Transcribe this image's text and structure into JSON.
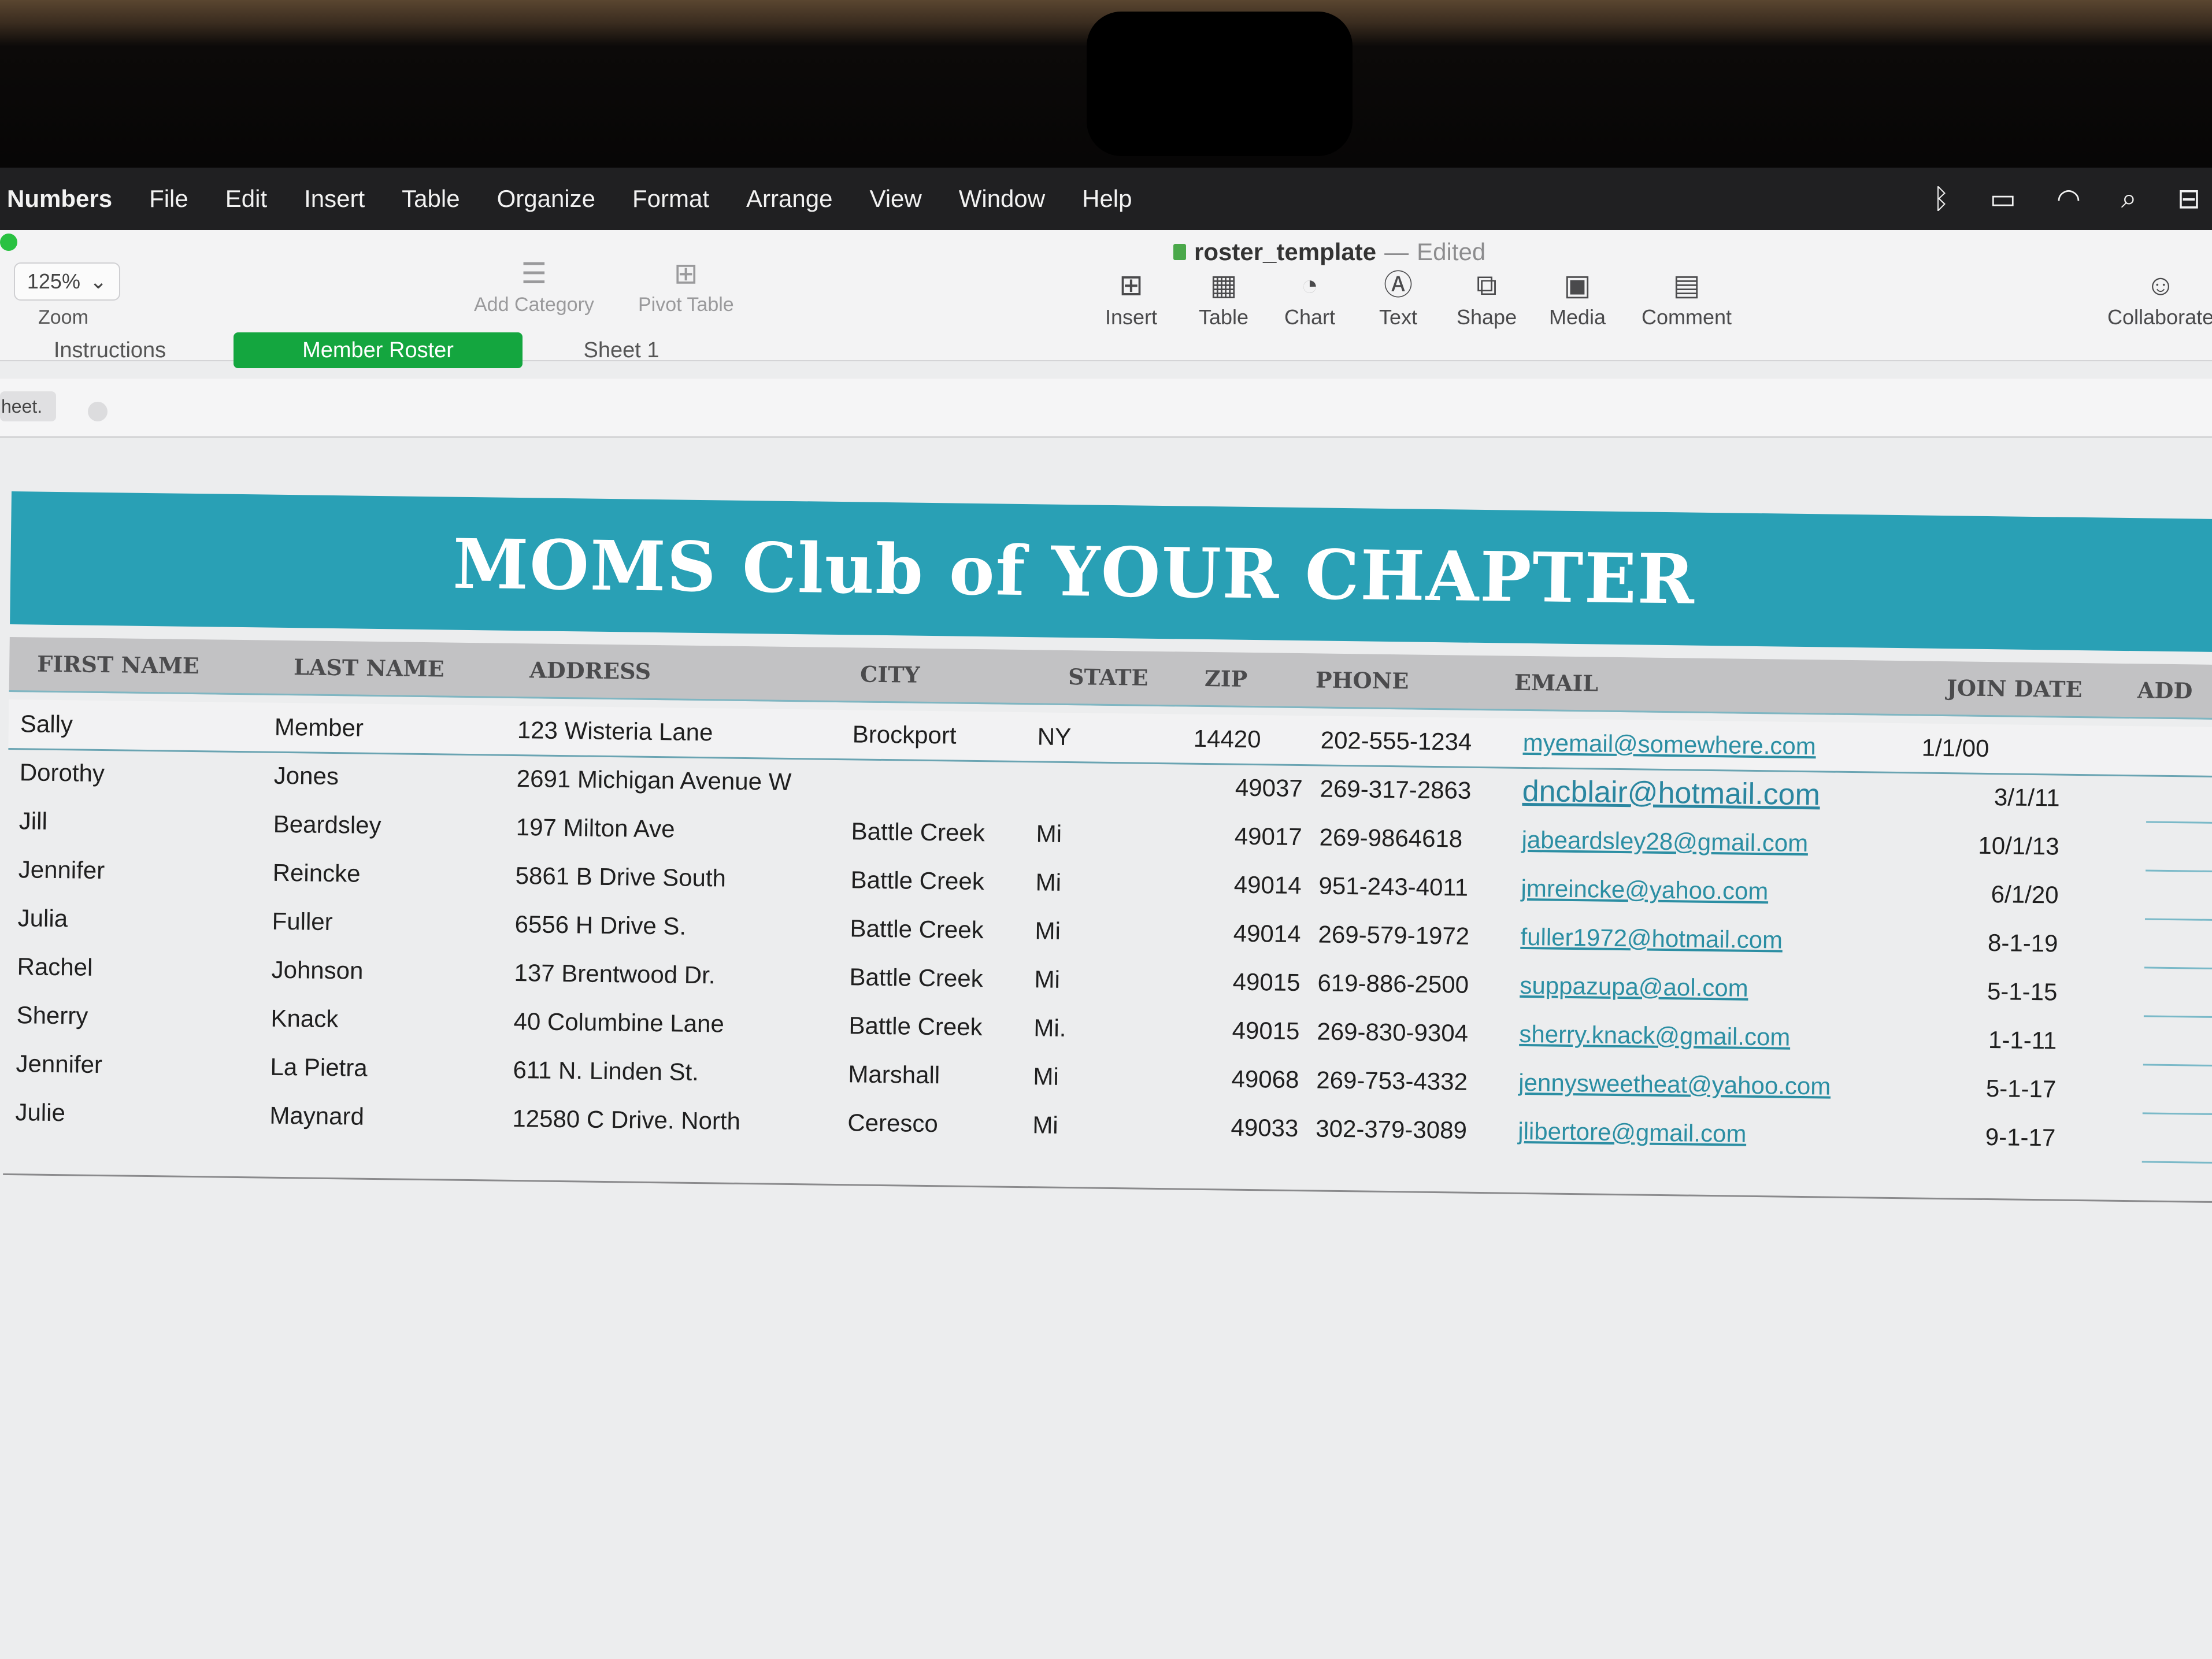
{
  "menubar": {
    "app": "Numbers",
    "items": [
      "File",
      "Edit",
      "Insert",
      "Table",
      "Organize",
      "Format",
      "Arrange",
      "View",
      "Window",
      "Help"
    ],
    "status_icons": [
      "bluetooth-icon",
      "battery-icon",
      "wifi-icon",
      "search-icon",
      "control-center-icon"
    ]
  },
  "document": {
    "name": "roster_template",
    "separator": "—",
    "state": "Edited"
  },
  "toolbar": {
    "zoom_value": "125%",
    "zoom_label": "Zoom",
    "add_category": "Add Category",
    "pivot_table": "Pivot Table",
    "insert": "Insert",
    "table": "Table",
    "chart": "Chart",
    "text": "Text",
    "shape": "Shape",
    "media": "Media",
    "comment": "Comment",
    "collaborate": "Collaborate"
  },
  "tabs": [
    "Instructions",
    "Member Roster",
    "Sheet 1"
  ],
  "active_tab": "Member Roster",
  "strip_hint": "heet.",
  "roster": {
    "title": "MOMS Club of YOUR CHAPTER",
    "columns": [
      "FIRST NAME",
      "LAST NAME",
      "ADDRESS",
      "CITY",
      "STATE",
      "ZIP",
      "PHONE",
      "EMAIL",
      "JOIN DATE",
      "ADD"
    ],
    "rows": [
      [
        "Sally",
        "Member",
        "123 Wisteria Lane",
        "Brockport",
        "NY",
        "14420",
        "202-555-1234",
        "myemail@somewhere.com",
        "1/1/00"
      ],
      [
        "Dorothy",
        "Jones",
        "2691 Michigan Avenue W",
        "",
        "",
        "49037",
        "269-317-2863",
        "dncblair@hotmail.com",
        "3/1/11"
      ],
      [
        "Jill",
        "Beardsley",
        "197 Milton Ave",
        "Battle Creek",
        "Mi",
        "49017",
        "269-9864618",
        "jabeardsley28@gmail.com",
        "10/1/13"
      ],
      [
        "Jennifer",
        "Reincke",
        "5861 B Drive South",
        "Battle Creek",
        "Mi",
        "49014",
        "951-243-4011",
        "jmreincke@yahoo.com",
        "6/1/20"
      ],
      [
        "Julia",
        "Fuller",
        "6556 H Drive S.",
        "Battle Creek",
        "Mi",
        "49014",
        "269-579-1972",
        "fuller1972@hotmail.com",
        "8-1-19"
      ],
      [
        "Rachel",
        "Johnson",
        "137 Brentwood Dr.",
        "Battle Creek",
        "Mi",
        "49015",
        "619-886-2500",
        "suppazupa@aol.com",
        "5-1-15"
      ],
      [
        "Sherry",
        "Knack",
        "40 Columbine Lane",
        "Battle Creek",
        "Mi.",
        "49015",
        "269-830-9304",
        "sherry.knack@gmail.com",
        "1-1-11"
      ],
      [
        "Jennifer",
        "La Pietra",
        "611 N. Linden St.",
        "Marshall",
        "Mi",
        "49068",
        "269-753-4332",
        "jennysweetheat@yahoo.com",
        "5-1-17"
      ],
      [
        "Julie",
        "Maynard",
        "12580 C Drive. North",
        "Ceresco",
        "Mi",
        "49033",
        "302-379-3089",
        "jlibertore@gmail.com",
        "9-1-17"
      ]
    ]
  },
  "colors": {
    "banner": "#29a0b5",
    "active_tab": "#14a63f",
    "email_link": "#2b8ea3"
  }
}
